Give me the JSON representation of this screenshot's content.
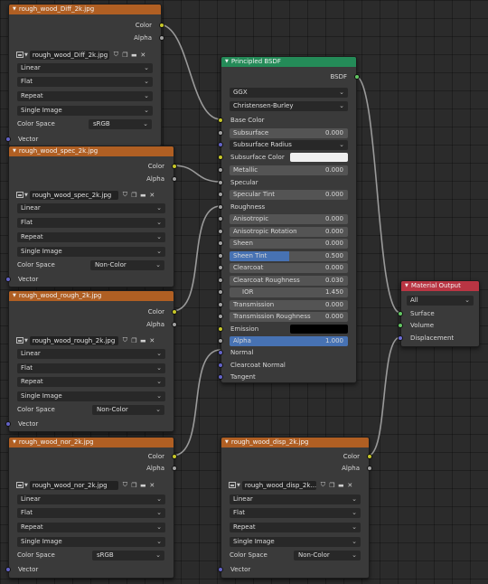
{
  "nodes": {
    "diff": {
      "title": "rough_wood_Diff_2k.jpg",
      "outputs": [
        "Color",
        "Alpha"
      ],
      "image_name": "rough_wood_Diff_2k.jpg",
      "interpolation": "Linear",
      "projection": "Flat",
      "extension": "Repeat",
      "source": "Single Image",
      "color_space_label": "Color Space",
      "color_space": "sRGB",
      "input": "Vector"
    },
    "spec": {
      "title": "rough_wood_spec_2k.jpg",
      "outputs": [
        "Color",
        "Alpha"
      ],
      "image_name": "rough_wood_spec_2k.jpg",
      "interpolation": "Linear",
      "projection": "Flat",
      "extension": "Repeat",
      "source": "Single Image",
      "color_space_label": "Color Space",
      "color_space": "Non-Color",
      "input": "Vector"
    },
    "rough": {
      "title": "rough_wood_rough_2k.jpg",
      "outputs": [
        "Color",
        "Alpha"
      ],
      "image_name": "rough_wood_rough_2k.jpg",
      "interpolation": "Linear",
      "projection": "Flat",
      "extension": "Repeat",
      "source": "Single Image",
      "color_space_label": "Color Space",
      "color_space": "Non-Color",
      "input": "Vector"
    },
    "nor": {
      "title": "rough_wood_nor_2k.jpg",
      "outputs": [
        "Color",
        "Alpha"
      ],
      "image_name": "rough_wood_nor_2k.jpg",
      "interpolation": "Linear",
      "projection": "Flat",
      "extension": "Repeat",
      "source": "Single Image",
      "color_space_label": "Color Space",
      "color_space": "sRGB",
      "input": "Vector"
    },
    "disp": {
      "title": "rough_wood_disp_2k.jpg",
      "outputs": [
        "Color",
        "Alpha"
      ],
      "image_name": "rough_wood_disp_2k...",
      "interpolation": "Linear",
      "projection": "Flat",
      "extension": "Repeat",
      "source": "Single Image",
      "color_space_label": "Color Space",
      "color_space": "Non-Color",
      "input": "Vector"
    },
    "bsdf": {
      "title": "Principled BSDF",
      "output": "BSDF",
      "distribution": "GGX",
      "subsurface_method": "Christensen-Burley",
      "base_color": "Base Color",
      "subsurface": {
        "label": "Subsurface",
        "value": "0.000"
      },
      "subsurface_radius": "Subsurface Radius",
      "subsurface_color": "Subsurface Color",
      "metallic": {
        "label": "Metallic",
        "value": "0.000"
      },
      "specular": "Specular",
      "specular_tint": {
        "label": "Specular Tint",
        "value": "0.000"
      },
      "roughness": "Roughness",
      "anisotropic": {
        "label": "Anisotropic",
        "value": "0.000"
      },
      "anisotropic_rotation": {
        "label": "Anisotropic Rotation",
        "value": "0.000"
      },
      "sheen": {
        "label": "Sheen",
        "value": "0.000"
      },
      "sheen_tint": {
        "label": "Sheen Tint",
        "value": "0.500",
        "fill": 0.5
      },
      "clearcoat": {
        "label": "Clearcoat",
        "value": "0.000"
      },
      "clearcoat_roughness": {
        "label": "Clearcoat Roughness",
        "value": "0.030"
      },
      "ior": {
        "label": "IOR",
        "value": "1.450"
      },
      "transmission": {
        "label": "Transmission",
        "value": "0.000"
      },
      "transmission_roughness": {
        "label": "Transmission Roughness",
        "value": "0.000"
      },
      "emission": "Emission",
      "alpha": {
        "label": "Alpha",
        "value": "1.000",
        "fill": 1.0
      },
      "normal": "Normal",
      "clearcoat_normal": "Clearcoat Normal",
      "tangent": "Tangent"
    },
    "output": {
      "title": "Material Output",
      "target": "All",
      "surface": "Surface",
      "volume": "Volume",
      "displacement": "Displacement"
    }
  },
  "colors": {
    "texture_header": "#b05f23",
    "shader_header": "#248b58",
    "output_header": "#b93543",
    "subsurface_color": "#f0f0f0",
    "emission_color": "#000000",
    "slider_fill": "#4772b3",
    "wire": "#9a9a9a"
  }
}
